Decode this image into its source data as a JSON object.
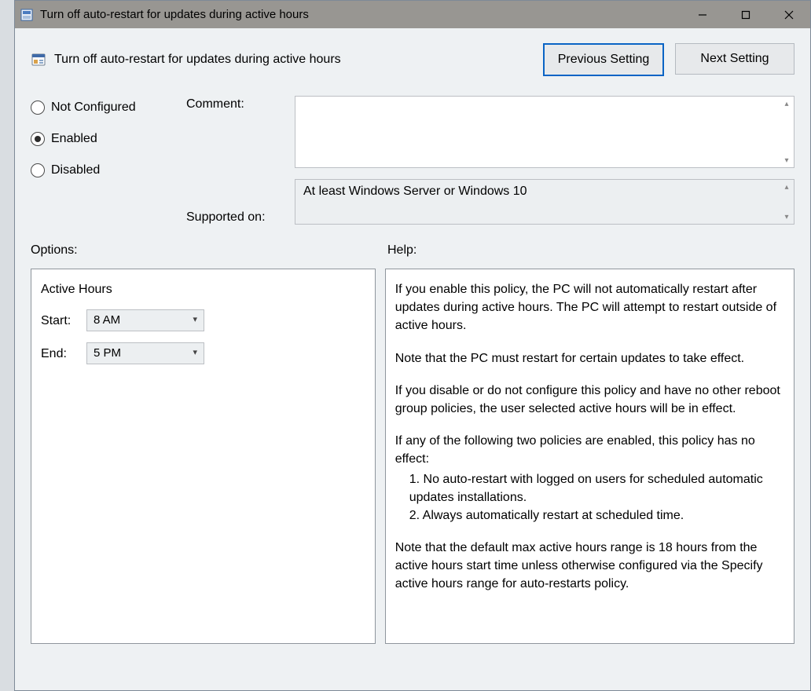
{
  "titlebar": {
    "title": "Turn off auto-restart for updates during active hours"
  },
  "header": {
    "policy_title": "Turn off auto-restart for updates during active hours",
    "prev_btn": "Previous Setting",
    "next_btn": "Next Setting"
  },
  "state": {
    "not_configured": "Not Configured",
    "enabled": "Enabled",
    "disabled": "Disabled",
    "selected": "enabled"
  },
  "labels": {
    "comment": "Comment:",
    "supported_on": "Supported on:",
    "options": "Options:",
    "help": "Help:"
  },
  "fields": {
    "comment_value": "",
    "supported_value": "At least Windows Server or Windows 10"
  },
  "options": {
    "heading": "Active Hours",
    "start_label": "Start:",
    "start_value": "8 AM",
    "end_label": "End:",
    "end_value": "5 PM"
  },
  "help": {
    "p1": "If you enable this policy, the PC will not automatically restart after updates during active hours. The PC will attempt to restart outside of active hours.",
    "p2": "Note that the PC must restart for certain updates to take effect.",
    "p3": "If you disable or do not configure this policy and have no other reboot group policies, the user selected active hours will be in effect.",
    "p4": "If any of the following two policies are enabled, this policy has no effect:",
    "p4a": "1. No auto-restart with logged on users for scheduled automatic updates installations.",
    "p4b": "2. Always automatically restart at scheduled time.",
    "p5": "Note that the default max active hours range is 18 hours from the active hours start time unless otherwise configured via the Specify active hours range for auto-restarts policy."
  }
}
